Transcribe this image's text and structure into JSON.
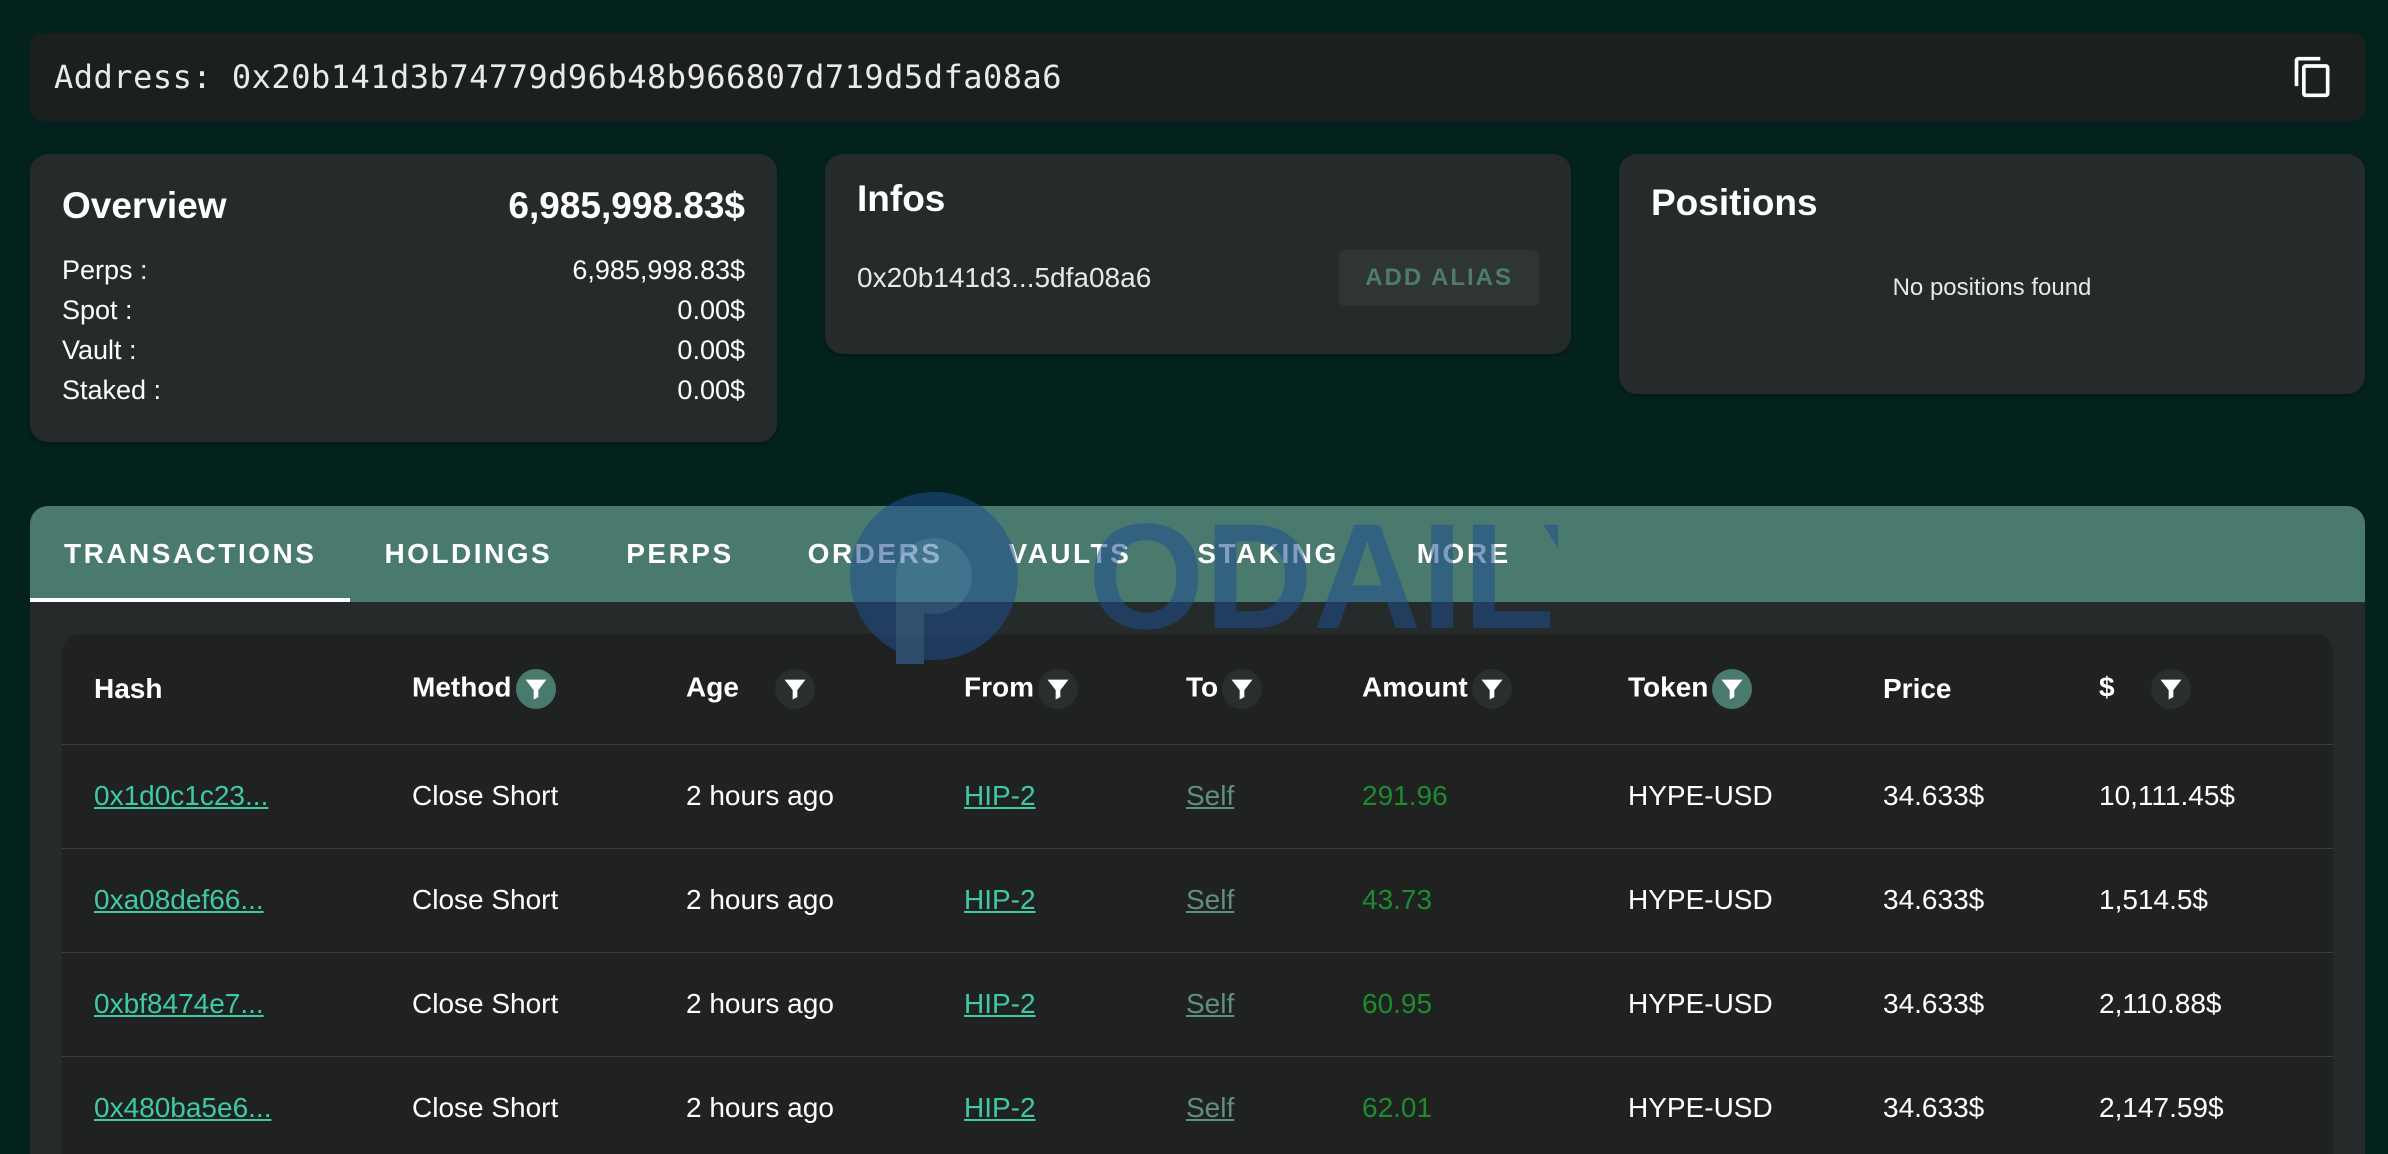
{
  "address_bar": {
    "label": "Address: 0x20b141d3b74779d96b48b966807d719d5dfa08a6"
  },
  "overview": {
    "title": "Overview",
    "total": "6,985,998.83$",
    "rows": [
      {
        "label": "Perps :",
        "value": "6,985,998.83$"
      },
      {
        "label": "Spot :",
        "value": "0.00$"
      },
      {
        "label": "Vault :",
        "value": "0.00$"
      },
      {
        "label": "Staked :",
        "value": "0.00$"
      }
    ]
  },
  "infos": {
    "title": "Infos",
    "short_address": "0x20b141d3...5dfa08a6",
    "add_alias_label": "ADD ALIAS"
  },
  "positions": {
    "title": "Positions",
    "empty_text": "No positions found"
  },
  "tabs": [
    {
      "label": "TRANSACTIONS",
      "active": true
    },
    {
      "label": "HOLDINGS"
    },
    {
      "label": "PERPS"
    },
    {
      "label": "ORDERS"
    },
    {
      "label": "VAULTS"
    },
    {
      "label": "STAKING"
    },
    {
      "label": "MORE"
    }
  ],
  "table": {
    "headers": {
      "hash": "Hash",
      "method": "Method",
      "age": "Age",
      "from": "From",
      "to": "To",
      "amount": "Amount",
      "token": "Token",
      "price": "Price",
      "usd": "$"
    },
    "rows": [
      {
        "hash": "0x1d0c1c23...",
        "method": "Close Short",
        "age": "2 hours ago",
        "from": "HIP-2",
        "to": "Self",
        "amount": "291.96",
        "token": "HYPE-USD",
        "price": "34.633$",
        "usd": "10,111.45$"
      },
      {
        "hash": "0xa08def66...",
        "method": "Close Short",
        "age": "2 hours ago",
        "from": "HIP-2",
        "to": "Self",
        "amount": "43.73",
        "token": "HYPE-USD",
        "price": "34.633$",
        "usd": "1,514.5$"
      },
      {
        "hash": "0xbf8474e7...",
        "method": "Close Short",
        "age": "2 hours ago",
        "from": "HIP-2",
        "to": "Self",
        "amount": "60.95",
        "token": "HYPE-USD",
        "price": "34.633$",
        "usd": "2,110.88$"
      },
      {
        "hash": "0x480ba5e6...",
        "method": "Close Short",
        "age": "2 hours ago",
        "from": "HIP-2",
        "to": "Self",
        "amount": "62.01",
        "token": "HYPE-USD",
        "price": "34.633$",
        "usd": "2,147.59$"
      }
    ]
  },
  "watermark": {
    "text": "ODAILY",
    "icon": "odaily-logo-icon"
  },
  "colors": {
    "background": "#04221d",
    "card": "#252b2a",
    "tab_bar": "#4a7a6e",
    "link": "#3ec9a7",
    "amount_green": "#1f8a2f"
  }
}
